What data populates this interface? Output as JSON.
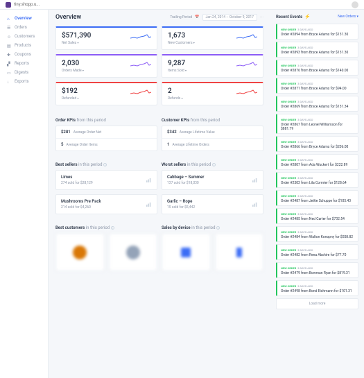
{
  "topbar": {
    "domain": "tiny.shopp.u..."
  },
  "sidebar": {
    "items": [
      {
        "label": "Overview",
        "active": true,
        "icon": "⌂"
      },
      {
        "label": "Orders",
        "icon": "☰"
      },
      {
        "label": "Customers",
        "icon": "☺"
      },
      {
        "label": "Products",
        "icon": "▤"
      },
      {
        "label": "Coupons",
        "icon": "✚"
      },
      {
        "label": "Reports",
        "icon": "▞"
      },
      {
        "label": "Digests",
        "icon": "▭"
      },
      {
        "label": "Exports",
        "icon": "↓"
      }
    ]
  },
  "header": {
    "title": "Overview",
    "trailing_label": "Trailing Period",
    "date_range": "Jan 24, 2014 – October 9, 2017"
  },
  "metrics": [
    {
      "value": "$571,390",
      "label": "Net Sales",
      "color": "blue"
    },
    {
      "value": "1,673",
      "label": "New Customers",
      "color": "blue"
    },
    {
      "value": "2,030",
      "label": "Orders Made",
      "color": "purple"
    },
    {
      "value": "9,287",
      "label": "Items Sold",
      "color": "purple"
    },
    {
      "value": "$192",
      "label": "Refunded",
      "color": "red"
    },
    {
      "value": "2",
      "label": "Refunds",
      "color": "red"
    }
  ],
  "order_kpis": {
    "title": "Order KPIs",
    "suffix": "from this period",
    "items": [
      {
        "val": "$281",
        "lbl": "Average Order Net"
      },
      {
        "val": "5",
        "lbl": "Average Order Items"
      }
    ]
  },
  "customer_kpis": {
    "title": "Customer KPIs",
    "suffix": "from this period",
    "items": [
      {
        "val": "$342",
        "lbl": "Average Lifetime Value"
      },
      {
        "val": "1",
        "lbl": "Average Lifetime Orders"
      }
    ]
  },
  "best_sellers": {
    "title": "Best sellers",
    "suffix": "in this period",
    "items": [
      {
        "name": "Limes",
        "stat": "274 sold for $28,129"
      },
      {
        "name": "Mushrooms Pre Pack",
        "stat": "214 sold for $4,260"
      }
    ]
  },
  "worst_sellers": {
    "title": "Worst sellers",
    "suffix": "in this period",
    "items": [
      {
        "name": "Cabbage – Summer",
        "stat": "137 sold for $18,030"
      },
      {
        "name": "Garlic – Rope",
        "stat": "15 sold for $5,442"
      }
    ]
  },
  "best_customers": {
    "title": "Best customers",
    "suffix": "in this period"
  },
  "sales_device": {
    "title": "Sales by device",
    "suffix": "in this period"
  },
  "events": {
    "title": "Recent Events",
    "link": "New Orders",
    "load_more": "Load more",
    "items": [
      {
        "tag": "NEW ORDER",
        "time": "3 DAYS AGO",
        "text": "Order #2894 from Bryce Adams for $131.30"
      },
      {
        "tag": "NEW ORDER",
        "time": "3 DAYS AGO",
        "text": "Order #2893 from Bryce Adams for $131.30"
      },
      {
        "tag": "NEW ORDER",
        "time": "3 DAYS AGO",
        "text": "Order #2876 from Bryce Adams for $140.00"
      },
      {
        "tag": "NEW ORDER",
        "time": "3 DAYS AGO",
        "text": "Order #2871 from Bryce Adams for $94.00"
      },
      {
        "tag": "NEW ORDER",
        "time": "3 DAYS AGO",
        "text": "Order #2869 from Bryce Adams for $131.34"
      },
      {
        "tag": "NEW ORDER",
        "time": "3 DAYS AGO",
        "text": "Order #2867 from Leonel Williamson for $881.79"
      },
      {
        "tag": "NEW ORDER",
        "time": "3 DAYS AGO",
        "text": "Order #2866 from Bryce Adams for $206.00"
      },
      {
        "tag": "NEW ORDER",
        "time": "3 DAYS AGO",
        "text": "Order #2807 from Ada Wuckert for $222.89"
      },
      {
        "tag": "NEW ORDER",
        "time": "3 DAYS AGO",
        "text": "Order #2503 from Lila Cormier for $128.64"
      },
      {
        "tag": "NEW ORDER",
        "time": "3 DAYS AGO",
        "text": "Order #2487 from Jettie Schuppe for $105.43"
      },
      {
        "tag": "NEW ORDER",
        "time": "3 DAYS AGO",
        "text": "Order #2485 from Ned Carter for $732.54"
      },
      {
        "tag": "NEW ORDER",
        "time": "3 DAYS AGO",
        "text": "Order #2484 from Walton Konopny for $558.82"
      },
      {
        "tag": "NEW ORDER",
        "time": "3 DAYS AGO",
        "text": "Order #2482 from Rena Abshire for $77.70"
      },
      {
        "tag": "NEW ORDER",
        "time": "3 DAYS AGO",
        "text": "Order #2479 from Bowman Ryan for $819.31"
      },
      {
        "tag": "NEW ORDER",
        "time": "3 DAYS AGO",
        "text": "Order #2498 from Bond Eichmann for $101.31"
      }
    ]
  }
}
